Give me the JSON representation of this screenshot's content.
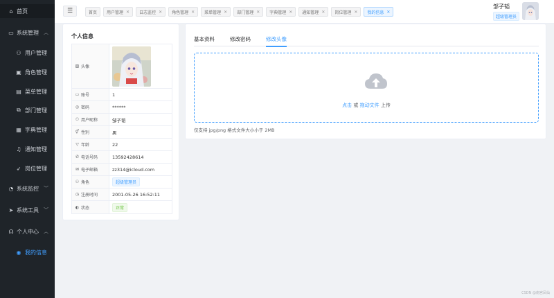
{
  "sidebar": {
    "items": [
      {
        "label": "首页",
        "icon": "home-icon"
      },
      {
        "label": "系统管理",
        "icon": "monitor-icon"
      },
      {
        "label": "用户管理",
        "icon": "user-icon"
      },
      {
        "label": "角色管理",
        "icon": "role-icon"
      },
      {
        "label": "菜单管理",
        "icon": "menu-icon"
      },
      {
        "label": "部门管理",
        "icon": "dept-icon"
      },
      {
        "label": "字典管理",
        "icon": "dict-icon"
      },
      {
        "label": "通知管理",
        "icon": "bell-icon"
      },
      {
        "label": "岗位管理",
        "icon": "post-icon"
      },
      {
        "label": "系统监控",
        "icon": "gauge-icon"
      },
      {
        "label": "系统工具",
        "icon": "send-icon"
      },
      {
        "label": "个人中心",
        "icon": "headset-icon"
      },
      {
        "label": "我的信息",
        "icon": "location-icon"
      }
    ]
  },
  "header": {
    "tags": [
      "首页",
      "用户管理",
      "日志监控",
      "角色管理",
      "菜单管理",
      "部门管理",
      "字典管理",
      "通知管理",
      "岗位管理",
      "我的信息"
    ],
    "active_tag": "我的信息",
    "user_name": "邹子韬",
    "user_role": "超级管理员"
  },
  "profile": {
    "title": "个人信息",
    "rows": [
      {
        "label": "头像",
        "icon": "image-icon",
        "value": ""
      },
      {
        "label": "账号",
        "icon": "monitor-icon",
        "value": "1"
      },
      {
        "label": "密码",
        "icon": "eye-icon",
        "value": "******"
      },
      {
        "label": "用户昵称",
        "icon": "user-icon",
        "value": "邹子韬"
      },
      {
        "label": "性别",
        "icon": "gender-icon",
        "value": "男"
      },
      {
        "label": "年龄",
        "icon": "filter-icon",
        "value": "22"
      },
      {
        "label": "电话号码",
        "icon": "phone-icon",
        "value": "13592428614"
      },
      {
        "label": "电子邮箱",
        "icon": "mail-icon",
        "value": "zz314@icloud.com"
      },
      {
        "label": "角色",
        "icon": "role-icon",
        "value": "超级管理员"
      },
      {
        "label": "注册时间",
        "icon": "clock-icon",
        "value": "2001-05-26 16:52:11"
      },
      {
        "label": "状态",
        "icon": "toggle-icon",
        "value": "正常"
      }
    ]
  },
  "tabs": {
    "items": [
      "基本资料",
      "修改密码",
      "修改头像"
    ],
    "active": "修改头像"
  },
  "upload": {
    "click": "点击",
    "or": "或",
    "drag": "拖动文件",
    "upload": "上传",
    "tip": "仅支持 jpg/png 格式文件大小小于 2MB"
  },
  "watermark": "CSDN @南宫凤仙",
  "colors": {
    "accent": "#409eff",
    "sidebar_bg": "#1f2429",
    "success": "#67c23a"
  }
}
